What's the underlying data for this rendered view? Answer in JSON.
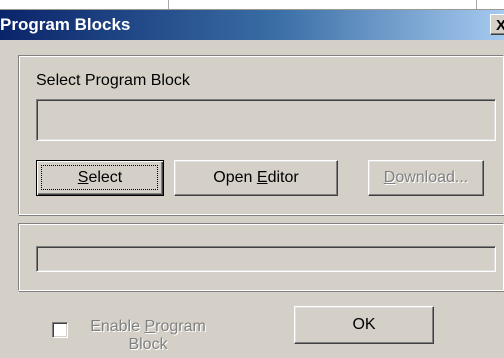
{
  "window": {
    "title": "Program Blocks",
    "close_glyph": "X"
  },
  "program_block": {
    "label": "Select Program Block",
    "value": ""
  },
  "buttons": {
    "select_pre": "",
    "select_mnemonic": "S",
    "select_post": "elect",
    "open_editor_pre": "Open ",
    "open_editor_mnemonic": "E",
    "open_editor_post": "ditor",
    "download_pre": "",
    "download_mnemonic": "D",
    "download_post": "ownload...",
    "ok": "OK"
  },
  "status": {
    "value": ""
  },
  "enable_checkbox": {
    "label_line1_pre": "Enable ",
    "label_line1_mnemonic": "P",
    "label_line1_post": "rogram",
    "label_line2": "Block",
    "checked": false,
    "enabled": false
  },
  "colors": {
    "title_gradient_start": "#0a246a",
    "title_gradient_end": "#a6caf0",
    "face": "#d4d0c8",
    "disabled_text": "#808080"
  }
}
